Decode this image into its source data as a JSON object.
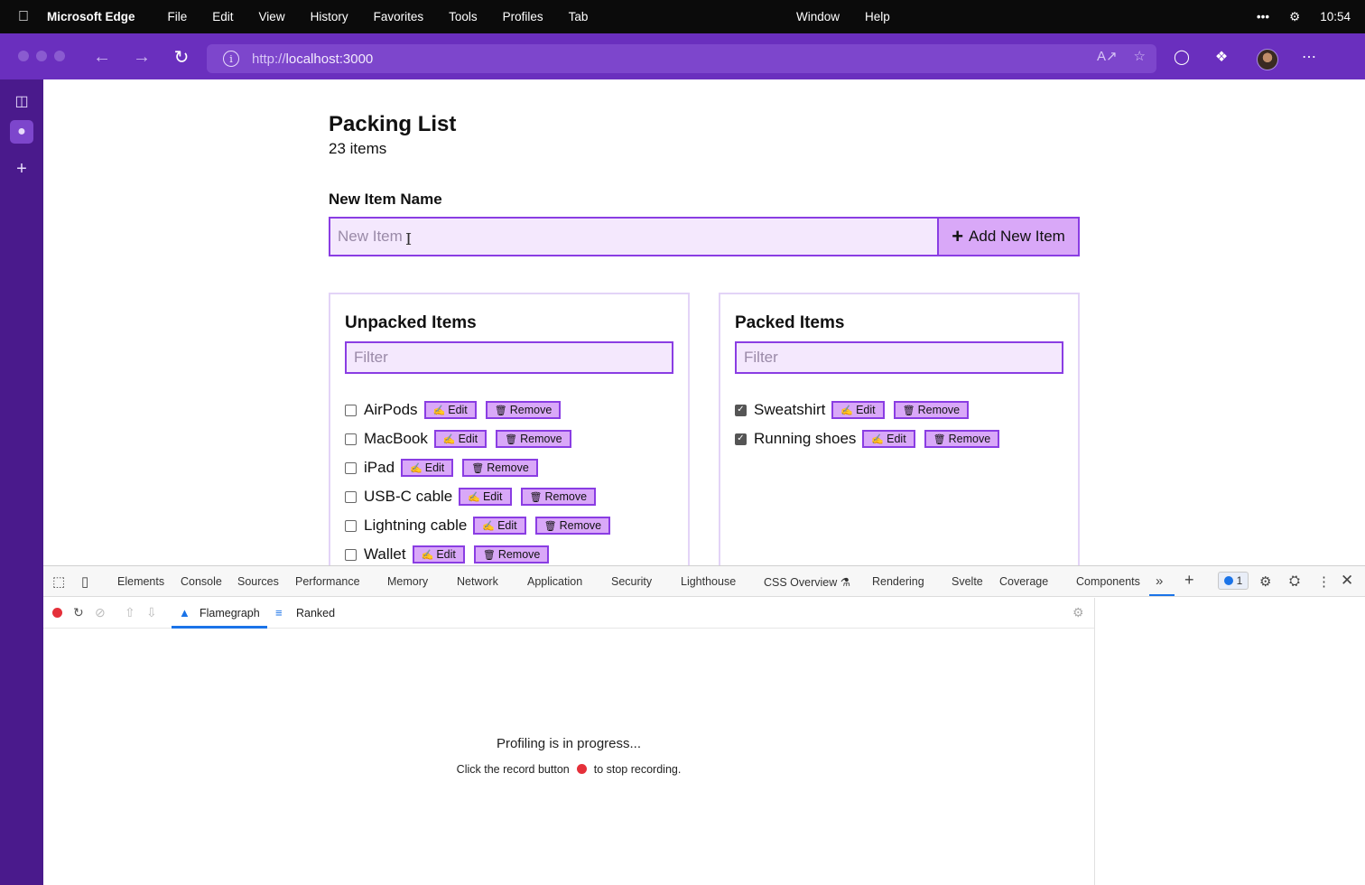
{
  "menubar": {
    "app_name": "Microsoft Edge",
    "items": [
      "File",
      "Edit",
      "View",
      "History",
      "Favorites",
      "Tools",
      "Profiles",
      "Tab"
    ],
    "right_items": [
      "Window",
      "Help"
    ],
    "clock": "10:54"
  },
  "browser": {
    "url_scheme": "http://",
    "url_host": "localhost:3000"
  },
  "page": {
    "title": "Packing List",
    "count": "23 items",
    "new_item_label": "New Item Name",
    "new_item_placeholder": "New Item",
    "add_button_label": "Add New Item",
    "unpacked": {
      "heading": "Unpacked Items",
      "filter_placeholder": "Filter",
      "items": [
        "AirPods",
        "MacBook",
        "iPad",
        "USB-C cable",
        "Lightning cable",
        "Wallet"
      ]
    },
    "packed": {
      "heading": "Packed Items",
      "filter_placeholder": "Filter",
      "items": [
        "Sweatshirt",
        "Running shoes"
      ]
    },
    "edit_label": "Edit",
    "remove_label": "Remove"
  },
  "devtools": {
    "tabs": [
      "Elements",
      "Console",
      "Sources",
      "Performance",
      "Memory",
      "Network",
      "Application",
      "Security",
      "Lighthouse",
      "CSS Overview",
      "Rendering",
      "Svelte",
      "Coverage",
      "Components"
    ],
    "issues_count": "1",
    "profiler_tabs": [
      "Flamegraph",
      "Ranked"
    ],
    "status_title": "Profiling is in progress...",
    "status_before": "Click the record button",
    "status_after": "to stop recording."
  },
  "colors": {
    "accent": "#8a3de3",
    "button_fill": "#d9a8f8",
    "input_fill": "#f4e8fd",
    "chrome": "#6a2fbe",
    "record": "#e5303a"
  }
}
